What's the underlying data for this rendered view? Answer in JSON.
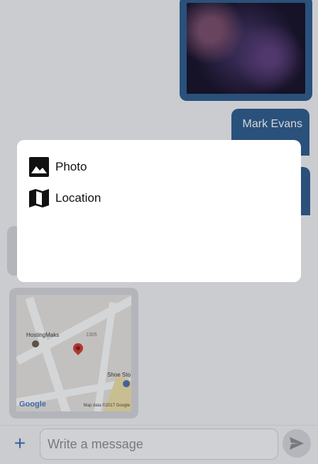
{
  "chat": {
    "sent_name": "Mark Evans",
    "map": {
      "place_label": "HostingMaks",
      "number_label": "1305",
      "shop_label": "Shoe Sto",
      "logo_text": "Google",
      "credit": "Map data ©2017 Google"
    }
  },
  "composer": {
    "add_icon": "plus-icon",
    "placeholder": "Write a message",
    "value": "",
    "send_icon": "send-icon"
  },
  "dialog": {
    "options": [
      {
        "label": "Photo",
        "icon": "image-icon"
      },
      {
        "label": "Location",
        "icon": "map-icon"
      }
    ]
  },
  "colors": {
    "accent": "#2b5a8c",
    "plus": "#3b6db3",
    "received_bubble": "#d6d8dc",
    "pin": "#d33a2c"
  }
}
